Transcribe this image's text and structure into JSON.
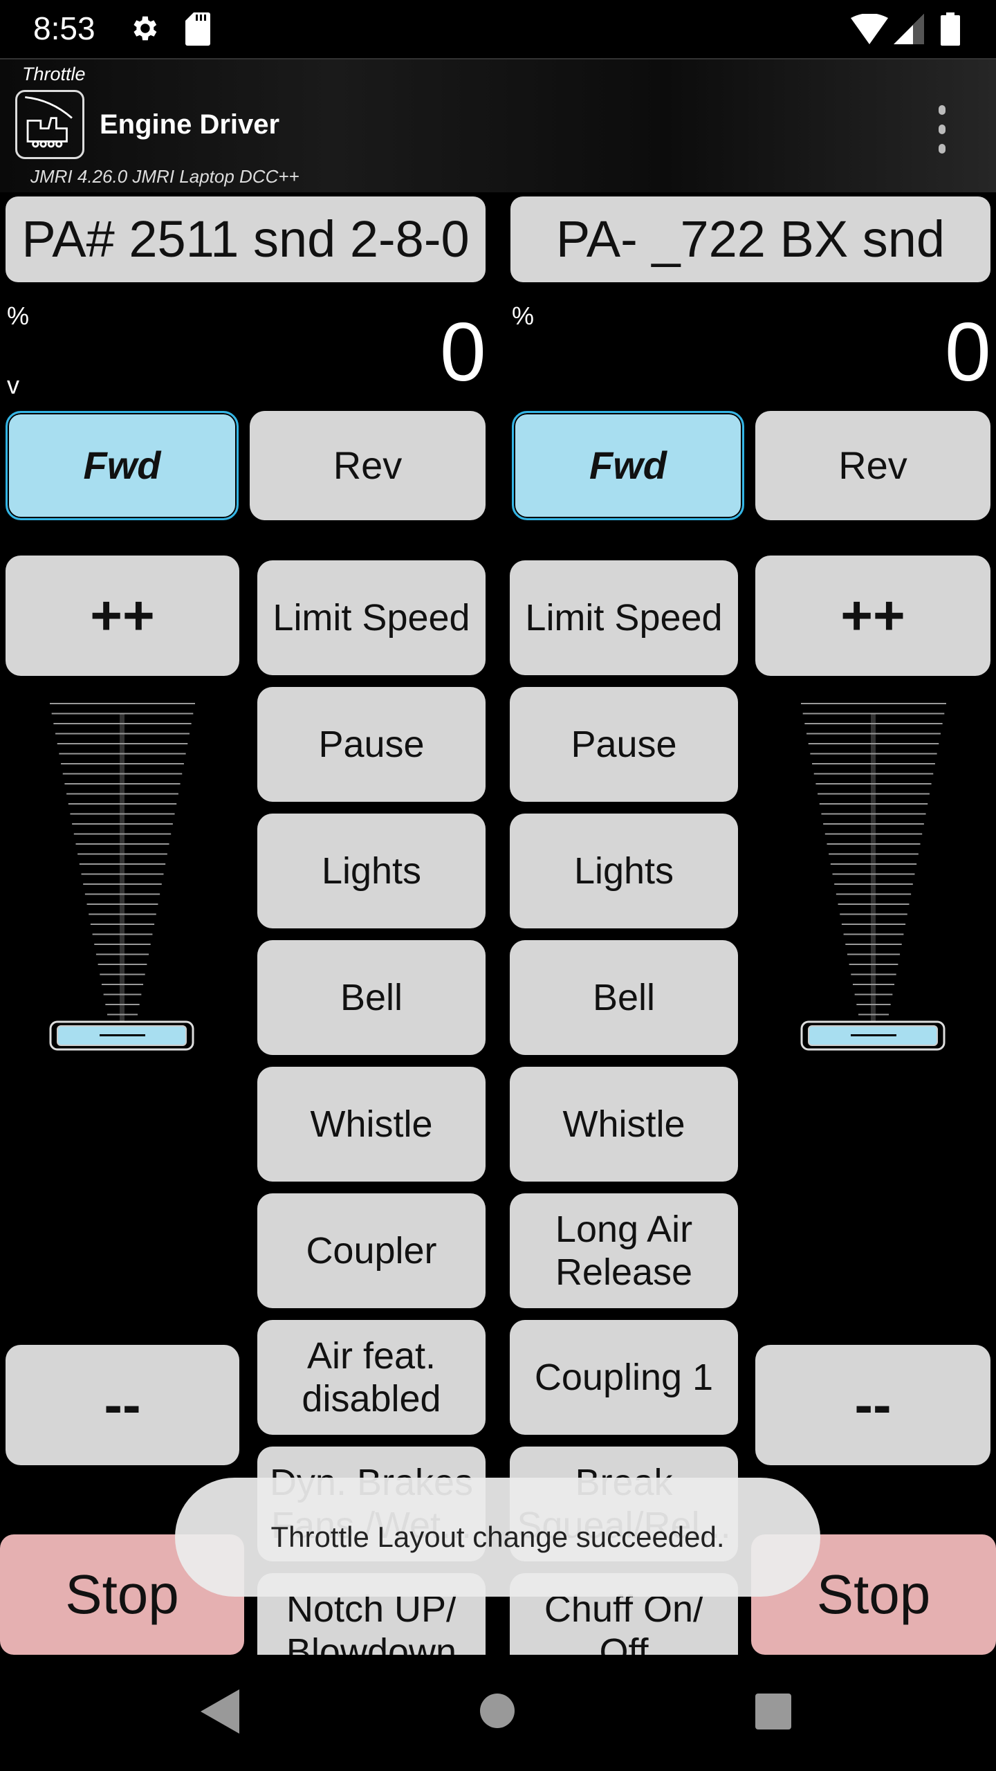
{
  "status_bar": {
    "time": "8:53",
    "icons": [
      "gear-icon",
      "sd-card-icon",
      "wifi-icon",
      "signal-icon",
      "battery-icon"
    ]
  },
  "app_bar": {
    "screen_label": "Throttle",
    "title": "Engine Driver",
    "subtitle": "JMRI 4.26.0 JMRI Laptop DCC++"
  },
  "throttles": [
    {
      "loco": "PA# 2511 snd 2-8-0",
      "speed_unit": "%",
      "speed": "0",
      "speed_step_label": "v",
      "fwd": "Fwd",
      "rev": "Rev",
      "increase": "++",
      "decrease": "--",
      "stop": "Stop",
      "slider_value": 0,
      "functions": [
        "Limit Speed",
        "Pause",
        "Lights",
        "Bell",
        "Whistle",
        "Coupler",
        "Air feat. disabled",
        "Dyn. Brakes Fans /Wet...",
        "Notch UP/ Blowdown"
      ]
    },
    {
      "loco": "PA- _722 BX snd",
      "speed_unit": "%",
      "speed": "0",
      "fwd": "Fwd",
      "rev": "Rev",
      "increase": "++",
      "decrease": "--",
      "stop": "Stop",
      "slider_value": 0,
      "functions": [
        "Limit Speed",
        "Pause",
        "Lights",
        "Bell",
        "Whistle",
        "Long Air Release",
        "Coupling 1",
        "Break Squeal/Rel...",
        "Chuff On/ Off"
      ]
    }
  ],
  "toast": "Throttle Layout change succeeded.",
  "colors": {
    "direction_active": "#a8def0",
    "stop": "#e5b0b1",
    "button": "#d6d6d6"
  }
}
